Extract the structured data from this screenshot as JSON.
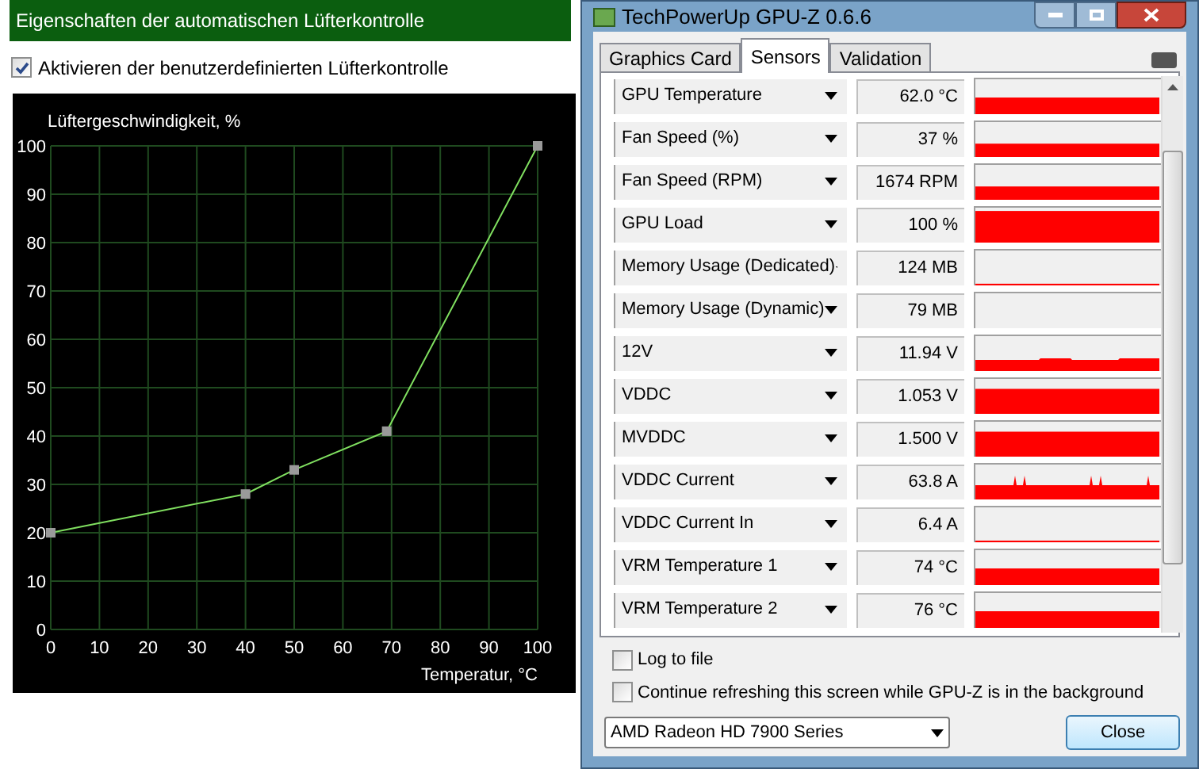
{
  "fan_panel": {
    "title": "Eigenschaften der automatischen Lüfterkontrolle",
    "enable_checkbox": {
      "label": "Aktivieren der benutzerdefinierten Lüfterkontrolle",
      "checked": true
    },
    "chart_data": {
      "type": "line",
      "xlabel": "Temperatur, °C",
      "ylabel": "Lüftergeschwindigkeit, %",
      "x": [
        0,
        40,
        50,
        69,
        100
      ],
      "grid": true,
      "series": [
        {
          "color": "#80e060",
          "marker": "square",
          "values": [
            20,
            28,
            33,
            41,
            100
          ]
        }
      ],
      "xlim": [
        0,
        100
      ],
      "ylim": [
        0,
        100
      ],
      "xticks": [
        0,
        10,
        20,
        30,
        40,
        50,
        60,
        70,
        80,
        90,
        100
      ],
      "yticks": [
        0,
        10,
        20,
        30,
        40,
        50,
        60,
        70,
        80,
        90,
        100
      ]
    }
  },
  "gpuz": {
    "window": {
      "title": "TechPowerUp GPU-Z 0.6.6"
    },
    "tabs": [
      {
        "label": "Graphics Card",
        "selected": false
      },
      {
        "label": "Sensors",
        "selected": true
      },
      {
        "label": "Validation",
        "selected": false
      }
    ],
    "sensors": [
      {
        "name": "GPU Temperature",
        "value": "62.0 °C",
        "kind": "mid"
      },
      {
        "name": "Fan Speed (%)",
        "value": "37 %",
        "kind": "low"
      },
      {
        "name": "Fan Speed (RPM)",
        "value": "1674 RPM",
        "kind": "low"
      },
      {
        "name": "GPU Load",
        "value": "100 %",
        "kind": "full"
      },
      {
        "name": "Memory Usage (Dedicated)",
        "value": "124 MB",
        "kind": "line"
      },
      {
        "name": "Memory Usage (Dynamic)",
        "value": "79 MB",
        "kind": "empty"
      },
      {
        "name": "12V",
        "value": "11.94 V",
        "kind": "noisy"
      },
      {
        "name": "VDDC",
        "value": "1.053 V",
        "kind": "high"
      },
      {
        "name": "MVDDC",
        "value": "1.500 V",
        "kind": "high"
      },
      {
        "name": "VDDC Current",
        "value": "63.8 A",
        "kind": "spiky"
      },
      {
        "name": "VDDC Current In",
        "value": "6.4 A",
        "kind": "line"
      },
      {
        "name": "VRM Temperature 1",
        "value": "74 °C",
        "kind": "mid"
      },
      {
        "name": "VRM Temperature 2",
        "value": "76 °C",
        "kind": "mid"
      }
    ],
    "options": [
      {
        "label": "Log to file",
        "checked": false
      },
      {
        "label": "Continue refreshing this screen while GPU-Z is in the background",
        "checked": false
      }
    ],
    "device_select": {
      "value": "AMD Radeon HD 7900 Series"
    },
    "close_button": {
      "label": "Close"
    }
  }
}
